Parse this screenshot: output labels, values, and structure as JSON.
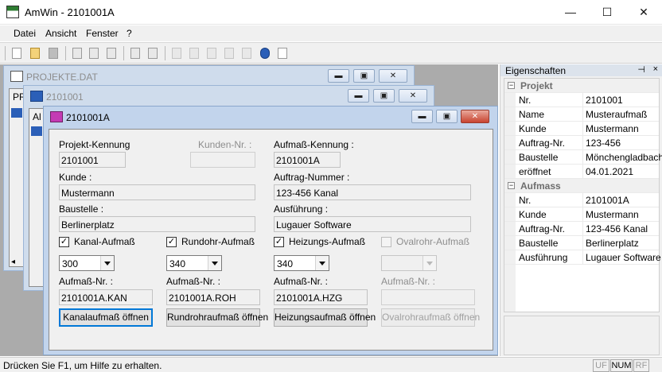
{
  "window": {
    "title": "AmWin - 2101001A",
    "min_glyph": "—",
    "max_glyph": "☐",
    "close_glyph": "✕"
  },
  "menu": [
    "Datei",
    "Ansicht",
    "Fenster",
    "?"
  ],
  "mdi_windows": {
    "projekte": {
      "title": "PROJEKTE.DAT",
      "fragment": "PR"
    },
    "mid": {
      "title": "2101001",
      "fragment": "Al"
    },
    "active": {
      "title": "2101001A"
    }
  },
  "form": {
    "projekt_kennung": {
      "label": "Projekt-Kennung",
      "value": "2101001"
    },
    "kunden_nr": {
      "label": "Kunden-Nr. :",
      "value": ""
    },
    "aufmass_kennung": {
      "label": "Aufmaß-Kennung :",
      "value": "2101001A"
    },
    "kunde": {
      "label": "Kunde :",
      "value": "Mustermann"
    },
    "auftrag_nummer": {
      "label": "Auftrag-Nummer :",
      "value": "123-456 Kanal"
    },
    "baustelle": {
      "label": "Baustelle :",
      "value": "Berlinerplatz"
    },
    "ausfuehrung": {
      "label": "Ausführung :",
      "value": "Lugauer Software"
    },
    "columns": [
      {
        "check_label": "Kanal-Aufmaß",
        "checked": true,
        "enabled": true,
        "combo": "300",
        "nr_label": "Aufmaß-Nr. :",
        "nr_value": "2101001A.KAN",
        "button": "Kanalaufmaß öffnen"
      },
      {
        "check_label": "Rundohr-Aufmaß",
        "checked": true,
        "enabled": true,
        "combo": "340",
        "nr_label": "Aufmaß-Nr. :",
        "nr_value": "2101001A.ROH",
        "button": "Rundrohraufmaß öffnen"
      },
      {
        "check_label": "Heizungs-Aufmaß",
        "checked": true,
        "enabled": true,
        "combo": "340",
        "nr_label": "Aufmaß-Nr. :",
        "nr_value": "2101001A.HZG",
        "button": "Heizungsaufmaß öffnen"
      },
      {
        "check_label": "Ovalrohr-Aufmaß",
        "checked": false,
        "enabled": false,
        "combo": "",
        "nr_label": "Aufmaß-Nr. :",
        "nr_value": "",
        "button": "Ovalrohraufmaß öffnen"
      }
    ]
  },
  "properties": {
    "title": "Eigenschaften",
    "pin_glyph": "📌",
    "close_glyph": "×",
    "groups": [
      {
        "name": "Projekt",
        "rows": [
          {
            "key": "Nr.",
            "value": "2101001"
          },
          {
            "key": "Name",
            "value": "Musteraufmaß"
          },
          {
            "key": "Kunde",
            "value": "Mustermann"
          },
          {
            "key": "Auftrag-Nr.",
            "value": "123-456"
          },
          {
            "key": "Baustelle",
            "value": "Mönchengladbach"
          },
          {
            "key": "eröffnet",
            "value": "04.01.2021"
          }
        ]
      },
      {
        "name": "Aufmass",
        "rows": [
          {
            "key": "Nr.",
            "value": "2101001A"
          },
          {
            "key": "Kunde",
            "value": "Mustermann"
          },
          {
            "key": "Auftrag-Nr.",
            "value": "123-456 Kanal"
          },
          {
            "key": "Baustelle",
            "value": "Berlinerplatz"
          },
          {
            "key": "Ausführung",
            "value": "Lugauer Software"
          }
        ]
      }
    ]
  },
  "status": {
    "text": "Drücken Sie F1, um Hilfe zu erhalten.",
    "indicators": [
      {
        "label": "UF",
        "active": false
      },
      {
        "label": "NUM",
        "active": true
      },
      {
        "label": "RF",
        "active": false
      }
    ]
  },
  "icons": [
    "app-icon",
    "new-icon",
    "open-icon",
    "save-icon",
    "cut-icon",
    "copy-icon",
    "paste-icon",
    "print-icon",
    "preview-icon",
    "help-icon",
    "context-help-icon"
  ]
}
